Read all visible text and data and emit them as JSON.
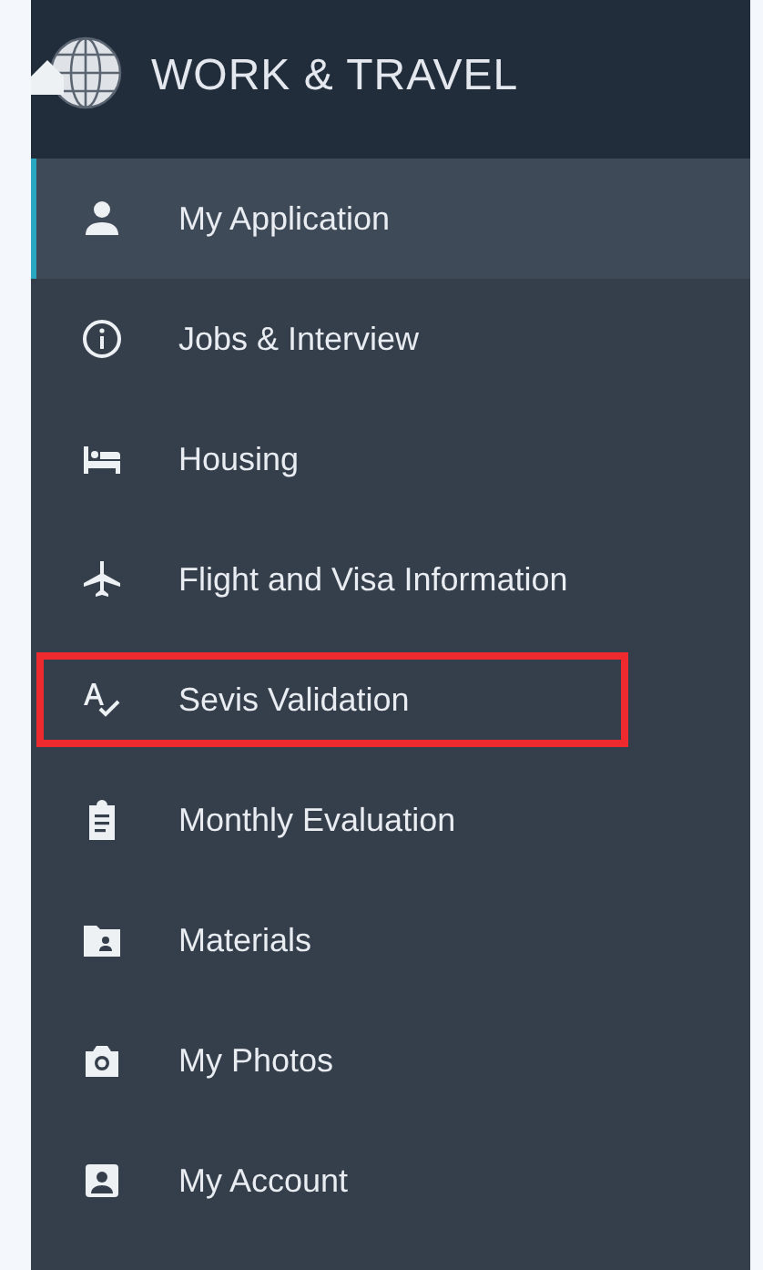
{
  "header": {
    "title": "WORK & TRAVEL"
  },
  "menu": [
    {
      "label": "My Application",
      "selected": true,
      "highlighted": false
    },
    {
      "label": "Jobs & Interview",
      "selected": false,
      "highlighted": false
    },
    {
      "label": "Housing",
      "selected": false,
      "highlighted": false
    },
    {
      "label": "Flight and Visa Information",
      "selected": false,
      "highlighted": false
    },
    {
      "label": "Sevis Validation",
      "selected": false,
      "highlighted": true
    },
    {
      "label": "Monthly Evaluation",
      "selected": false,
      "highlighted": false
    },
    {
      "label": "Materials",
      "selected": false,
      "highlighted": false
    },
    {
      "label": "My Photos",
      "selected": false,
      "highlighted": false
    },
    {
      "label": "My Account",
      "selected": false,
      "highlighted": false
    }
  ]
}
